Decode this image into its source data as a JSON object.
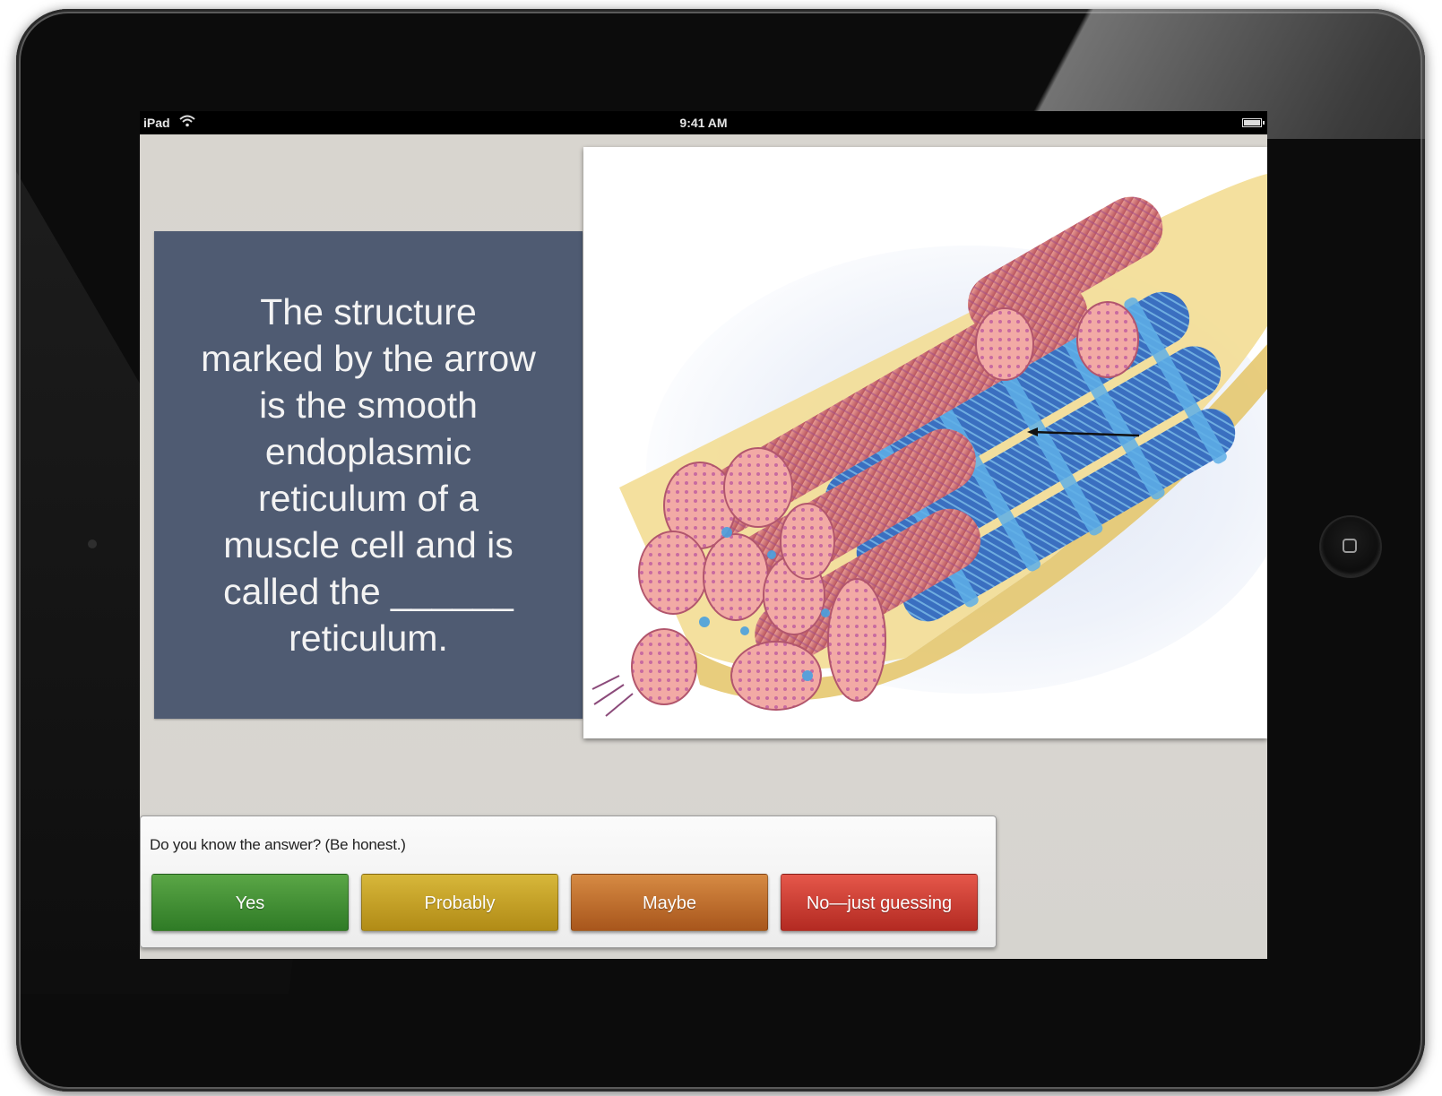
{
  "status_bar": {
    "carrier": "iPad",
    "time": "9:41 AM"
  },
  "question": {
    "text": "The structure marked by the arrow is the smooth endoplasmic reticulum of a muscle cell and is called the ______ reticulum."
  },
  "figure": {
    "subject": "muscle fiber cross-section illustration",
    "colors": {
      "myofibril": "#d97a78",
      "reticulum": "#3f8ed6",
      "sarcolemma": "#f1d68a"
    }
  },
  "answer_prompt": {
    "label": "Do you know the answer? (Be honest.)",
    "buttons": [
      {
        "label": "Yes",
        "color": "#3f8f33"
      },
      {
        "label": "Probably",
        "color": "#c6a12a"
      },
      {
        "label": "Maybe",
        "color": "#c06e2e"
      },
      {
        "label": "No—just guessing",
        "color": "#cf3f34"
      }
    ]
  },
  "icons": [
    "wifi-icon",
    "battery-icon",
    "home-button-icon",
    "arrow-icon"
  ]
}
